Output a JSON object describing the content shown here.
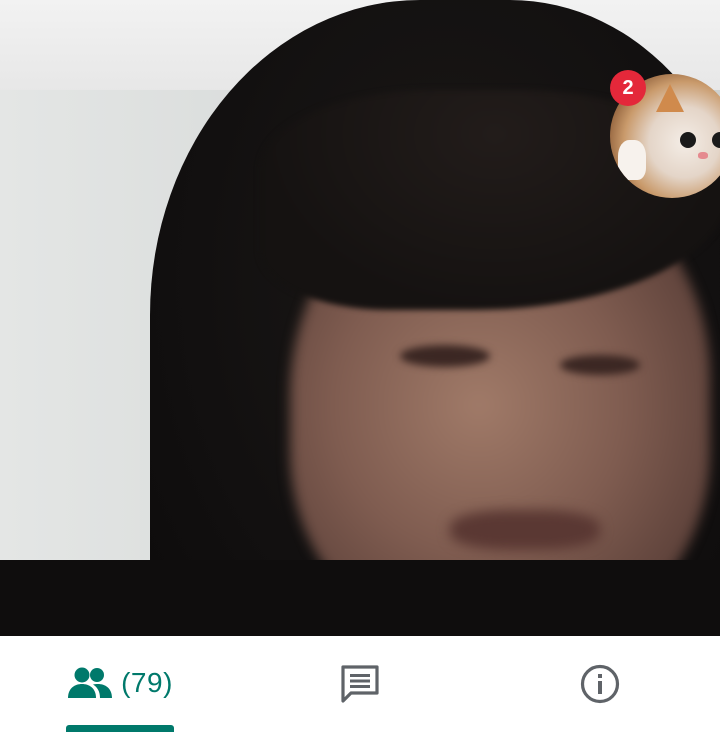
{
  "call": {
    "participant_count": "(79)",
    "pip_badge": "2"
  },
  "bottom_nav": {
    "tabs": [
      {
        "id": "people",
        "icon": "people-icon",
        "label": "(79)",
        "active": true
      },
      {
        "id": "chat",
        "icon": "chat-icon",
        "active": false
      },
      {
        "id": "info",
        "icon": "info-icon",
        "active": false
      }
    ]
  },
  "colors": {
    "accent": "#00796b",
    "badge": "#e4283a",
    "inactive_icon": "#5f6368"
  }
}
